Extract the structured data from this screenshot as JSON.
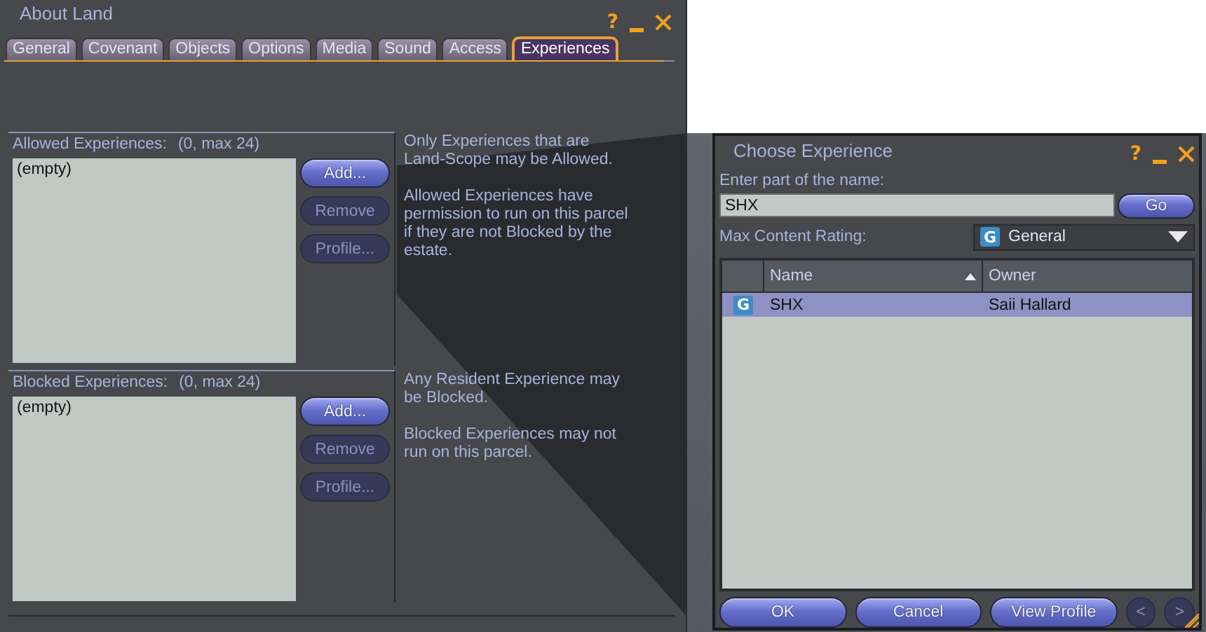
{
  "about_land": {
    "title": "About Land",
    "help_button": "?",
    "tabs": [
      {
        "label": "General",
        "selected": false
      },
      {
        "label": "Covenant",
        "selected": false
      },
      {
        "label": "Objects",
        "selected": false
      },
      {
        "label": "Options",
        "selected": false
      },
      {
        "label": "Media",
        "selected": false
      },
      {
        "label": "Sound",
        "selected": false
      },
      {
        "label": "Access",
        "selected": false
      },
      {
        "label": "Experiences",
        "selected": true
      }
    ],
    "sections": [
      {
        "label": "Allowed Experiences:",
        "count": "(0, max 24)",
        "items": [
          "(empty)"
        ],
        "buttons": [
          {
            "label": "Add...",
            "disabled": false
          },
          {
            "label": "Remove",
            "disabled": true
          },
          {
            "label": "Profile...",
            "disabled": true
          }
        ],
        "notes": [
          "Only Experiences that are Land-Scope may be Allowed.",
          "Allowed Experiences have permission to run on this parcel if they are not Blocked by the estate."
        ]
      },
      {
        "label": "Blocked Experiences:",
        "count": "(0, max 24)",
        "items": [
          "(empty)"
        ],
        "buttons": [
          {
            "label": "Add...",
            "disabled": false
          },
          {
            "label": "Remove",
            "disabled": true
          },
          {
            "label": "Profile...",
            "disabled": true
          }
        ],
        "notes": [
          "Any Resident Experience may be Blocked.",
          "Blocked Experiences may not run on this parcel."
        ]
      }
    ]
  },
  "choose_experience": {
    "title": "Choose Experience",
    "help_button": "?",
    "name_label": "Enter part of the name:",
    "name_value": "SHX",
    "go_button": "Go",
    "rating_label": "Max Content Rating:",
    "rating": {
      "badge": "G",
      "value": "General"
    },
    "columns": [
      {
        "label": "Name",
        "sorted": true
      },
      {
        "label": "Owner",
        "sorted": false
      }
    ],
    "rows": [
      {
        "badge": "G",
        "name": "SHX",
        "owner": "Saii Hallard",
        "selected": true
      }
    ],
    "buttons": [
      {
        "label": "OK",
        "disabled": false
      },
      {
        "label": "Cancel",
        "disabled": false
      },
      {
        "label": "View Profile",
        "disabled": false
      },
      {
        "label": "<",
        "disabled": true
      },
      {
        "label": ">",
        "disabled": true
      }
    ]
  }
}
